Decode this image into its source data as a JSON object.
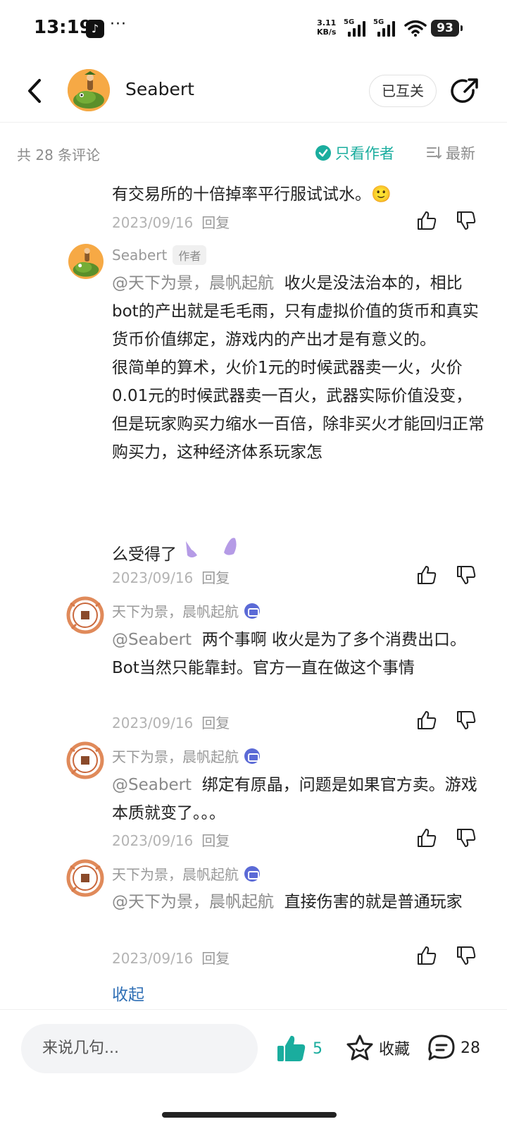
{
  "status_bar": {
    "time": "13:19",
    "more": "···",
    "speed_top": "3.11",
    "speed_bottom": "KB/s",
    "sim1": "5G",
    "sim2": "5G",
    "battery": "93"
  },
  "header": {
    "back_icon": "chevron-left-icon",
    "username": "Seabert",
    "follow_status": "已互关",
    "share_icon": "share-icon"
  },
  "filter": {
    "count_label": "共 28 条评论",
    "author_only": "只看作者",
    "sort": "最新"
  },
  "comments": [
    {
      "text": "有交易所的十倍掉率平行服试试水。",
      "emoji": "🙂",
      "date": "2023/09/16",
      "reply": "回复"
    },
    {
      "author": "Seabert",
      "author_tag": "作者",
      "mention": "@天下为景，晨帆起航",
      "text_1": "收火是没法治本的，相比bot的产出就是毛毛雨，只有虚拟价值的货币和真实货币价值绑定，游戏内的产出才是有意义的。",
      "text_2": "很简单的算术，火价1元的时候武器卖一火，火价0.01元的时候武器卖一百火，武器实际价值没变，但是玩家购买力缩水一百倍，除非买火才能回归正常购买力，这种经济体系玩家怎",
      "text_3": "么受得了",
      "date": "2023/09/16",
      "reply": "回复"
    },
    {
      "author": "天下为景，晨帆起航",
      "mention": "@Seabert",
      "text": "两个事啊  收火是为了多个消费出口。  Bot当然只能靠封。官方一直在做这个事情",
      "date": "2023/09/16",
      "reply": "回复"
    },
    {
      "author": "天下为景，晨帆起航",
      "mention": "@Seabert",
      "text": "绑定有原晶，问题是如果官方卖。游戏本质就变了。。。",
      "date": "2023/09/16",
      "reply": "回复"
    },
    {
      "author": "天下为景，晨帆起航",
      "mention": "@天下为景，晨帆起航",
      "text": "直接伤害的就是普通玩家",
      "date": "2023/09/16",
      "reply": "回复"
    }
  ],
  "collapse_label": "收起",
  "bottom_bar": {
    "input_placeholder": "来说几句...",
    "likes": "5",
    "favorite_label": "收藏",
    "comments_count": "28"
  },
  "colors": {
    "accent": "#1aad9e",
    "link": "#2f6fb5",
    "muted": "#b3b3b3"
  }
}
